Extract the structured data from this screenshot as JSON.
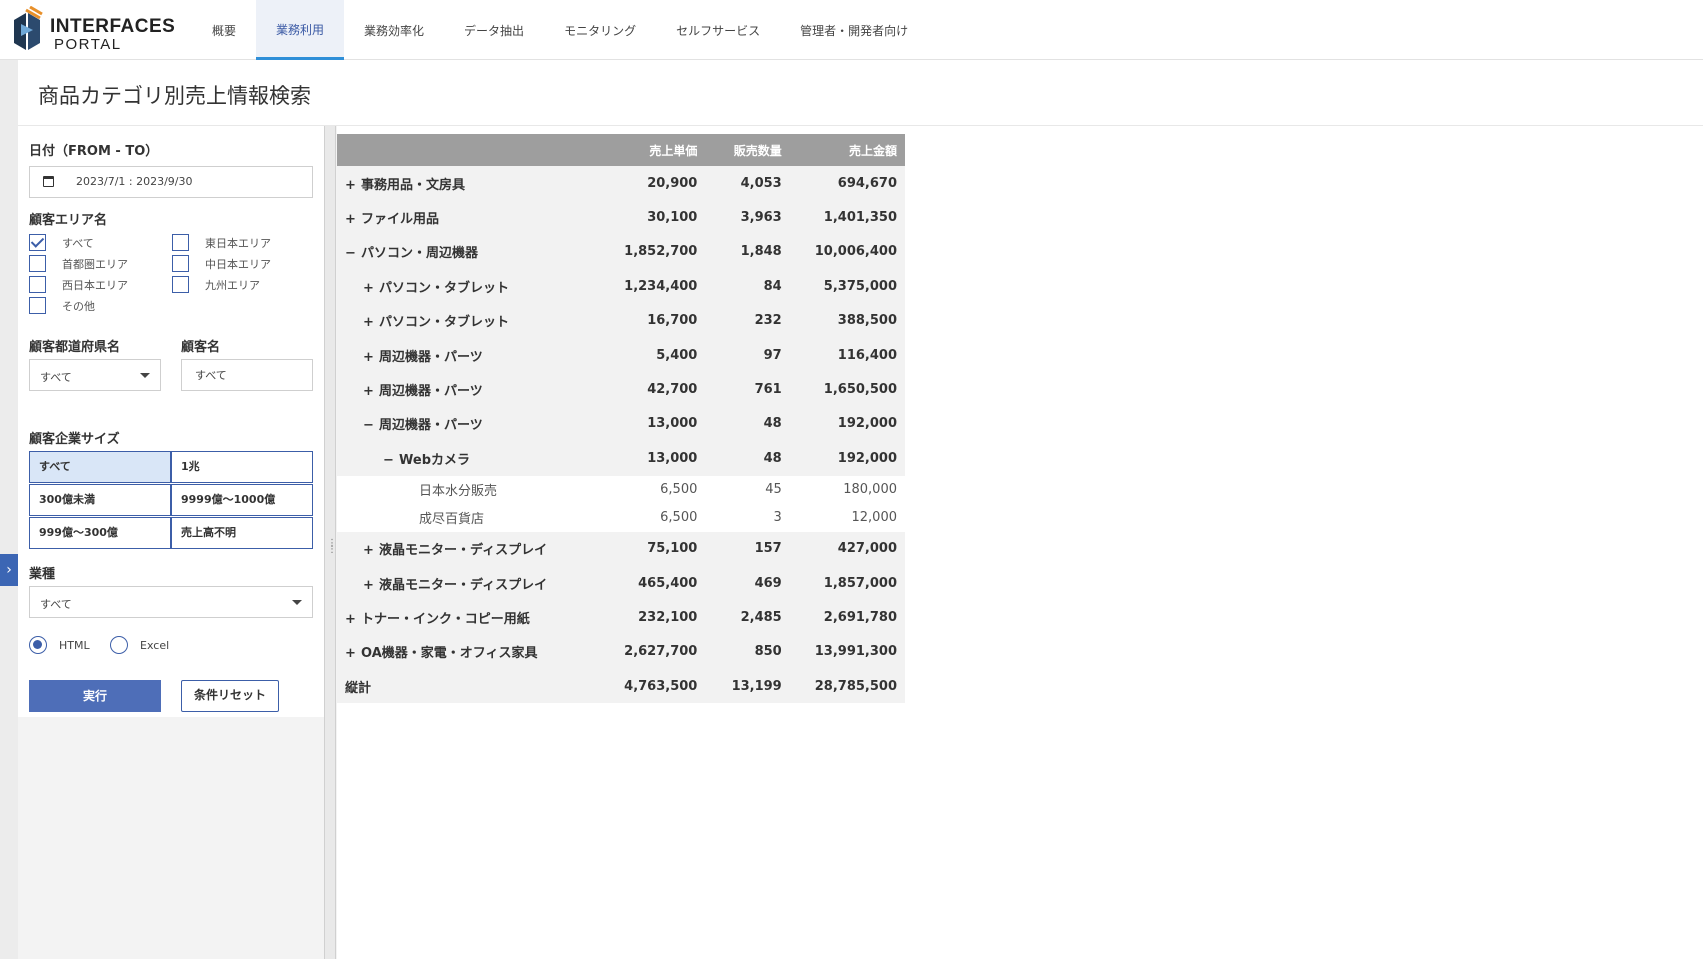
{
  "logo": {
    "line1": "INTERFACES",
    "line2": "PORTAL"
  },
  "nav": {
    "tabs": [
      {
        "label": "概要"
      },
      {
        "label": "業務利用"
      },
      {
        "label": "業務効率化"
      },
      {
        "label": "データ抽出"
      },
      {
        "label": "モニタリング"
      },
      {
        "label": "セルフサービス"
      },
      {
        "label": "管理者・開発者向け"
      }
    ],
    "active_index": 1
  },
  "page": {
    "title": "商品カテゴリ別売上情報検索"
  },
  "filters": {
    "date": {
      "label": "日付（FROM - TO）",
      "value": "2023/7/1 : 2023/9/30"
    },
    "area": {
      "label": "顧客エリア名",
      "options": [
        {
          "label": "すべて",
          "checked": true
        },
        {
          "label": "東日本エリア",
          "checked": false
        },
        {
          "label": "首都圏エリア",
          "checked": false
        },
        {
          "label": "中日本エリア",
          "checked": false
        },
        {
          "label": "西日本エリア",
          "checked": false
        },
        {
          "label": "九州エリア",
          "checked": false
        },
        {
          "label": "その他",
          "checked": false
        }
      ]
    },
    "prefecture": {
      "label": "顧客都道府県名",
      "value": "すべて"
    },
    "customer": {
      "label": "顧客名",
      "value": "すべて"
    },
    "company_size": {
      "label": "顧客企業サイズ",
      "options": [
        {
          "label": "すべて",
          "active": true
        },
        {
          "label": "1兆",
          "active": false
        },
        {
          "label": "300億未満",
          "active": false
        },
        {
          "label": "9999億～1000億",
          "active": false
        },
        {
          "label": "999億～300億",
          "active": false
        },
        {
          "label": "売上高不明",
          "active": false
        }
      ]
    },
    "industry": {
      "label": "業種",
      "value": "すべて"
    },
    "format": {
      "options": [
        {
          "label": "HTML",
          "selected": true
        },
        {
          "label": "Excel",
          "selected": false
        }
      ]
    },
    "run_label": "実行",
    "reset_label": "条件リセット"
  },
  "table": {
    "columns": [
      "",
      "売上単価",
      "販売数量",
      "売上金額"
    ],
    "rows": [
      {
        "toggle": "+",
        "name": "事務用品・文房具",
        "unit_price": "20,900",
        "qty": "4,053",
        "amount": "694,670",
        "level": 0,
        "kind": "grp"
      },
      {
        "toggle": "+",
        "name": "ファイル用品",
        "unit_price": "30,100",
        "qty": "3,963",
        "amount": "1,401,350",
        "level": 0,
        "kind": "grp"
      },
      {
        "toggle": "−",
        "name": "パソコン・周辺機器",
        "unit_price": "1,852,700",
        "qty": "1,848",
        "amount": "10,006,400",
        "level": 0,
        "kind": "grp"
      },
      {
        "toggle": "+",
        "name": "パソコン・タブレット",
        "unit_price": "1,234,400",
        "qty": "84",
        "amount": "5,375,000",
        "level": 1,
        "kind": "grp"
      },
      {
        "toggle": "+",
        "name": "パソコン・タブレット",
        "unit_price": "16,700",
        "qty": "232",
        "amount": "388,500",
        "level": 1,
        "kind": "grp"
      },
      {
        "toggle": "+",
        "name": "周辺機器・パーツ",
        "unit_price": "5,400",
        "qty": "97",
        "amount": "116,400",
        "level": 1,
        "kind": "grp"
      },
      {
        "toggle": "+",
        "name": "周辺機器・パーツ",
        "unit_price": "42,700",
        "qty": "761",
        "amount": "1,650,500",
        "level": 1,
        "kind": "grp"
      },
      {
        "toggle": "−",
        "name": "周辺機器・パーツ",
        "unit_price": "13,000",
        "qty": "48",
        "amount": "192,000",
        "level": 1,
        "kind": "grp"
      },
      {
        "toggle": "−",
        "name": "Webカメラ",
        "unit_price": "13,000",
        "qty": "48",
        "amount": "192,000",
        "level": 2,
        "kind": "grp"
      },
      {
        "toggle": "",
        "name": "日本水分販売",
        "unit_price": "6,500",
        "qty": "45",
        "amount": "180,000",
        "level": 3,
        "kind": "detail"
      },
      {
        "toggle": "",
        "name": "成尽百貨店",
        "unit_price": "6,500",
        "qty": "3",
        "amount": "12,000",
        "level": 3,
        "kind": "detail"
      },
      {
        "toggle": "+",
        "name": "液晶モニター・ディスプレイ",
        "unit_price": "75,100",
        "qty": "157",
        "amount": "427,000",
        "level": 1,
        "kind": "grp"
      },
      {
        "toggle": "+",
        "name": "液晶モニター・ディスプレイ",
        "unit_price": "465,400",
        "qty": "469",
        "amount": "1,857,000",
        "level": 1,
        "kind": "grp"
      },
      {
        "toggle": "+",
        "name": "トナー・インク・コピー用紙",
        "unit_price": "232,100",
        "qty": "2,485",
        "amount": "2,691,780",
        "level": 0,
        "kind": "grp"
      },
      {
        "toggle": "+",
        "name": "OA機器・家電・オフィス家具",
        "unit_price": "2,627,700",
        "qty": "850",
        "amount": "13,991,300",
        "level": 0,
        "kind": "grp"
      },
      {
        "toggle": "",
        "name": "縦計",
        "unit_price": "4,763,500",
        "qty": "13,199",
        "amount": "28,785,500",
        "level": 0,
        "kind": "total"
      }
    ]
  },
  "colors": {
    "accent": "#3c5ea8",
    "primary_button": "#4e6eb8",
    "table_header": "#9e9e9e",
    "active_tab_underline": "#2f8fd8"
  }
}
